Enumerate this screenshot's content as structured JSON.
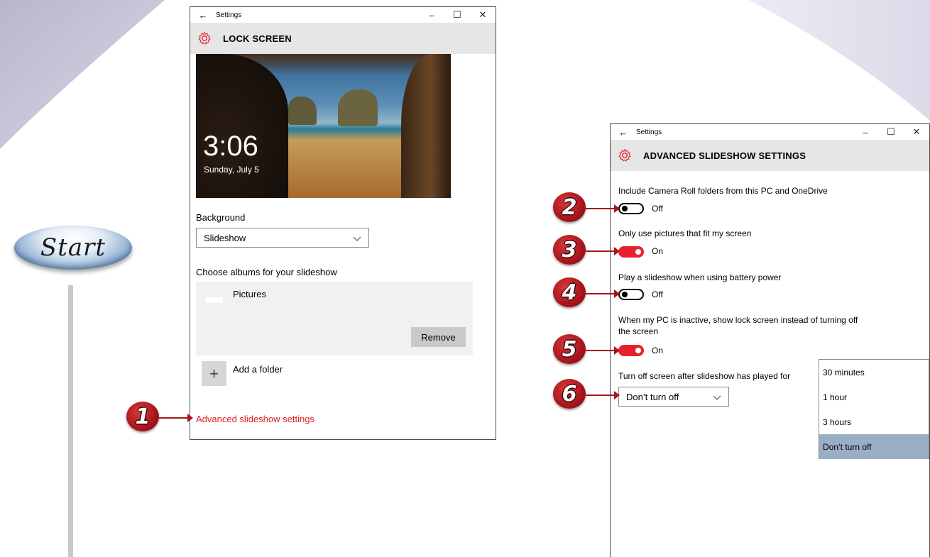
{
  "badge": {
    "label": "Start"
  },
  "window1": {
    "back_glyph": "←",
    "app_title": "Settings",
    "minimize_glyph": "–",
    "maximize_glyph": "☐",
    "close_glyph": "✕",
    "header_title": "LOCK SCREEN",
    "preview_time": "3:06",
    "preview_date": "Sunday, July 5",
    "background_label": "Background",
    "background_value": "Slideshow",
    "albums_label": "Choose albums for your slideshow",
    "album_name": "Pictures",
    "remove_label": "Remove",
    "add_folder_label": "Add a folder",
    "add_glyph": "+",
    "advanced_link": "Advanced slideshow settings"
  },
  "window2": {
    "back_glyph": "←",
    "app_title": "Settings",
    "minimize_glyph": "–",
    "maximize_glyph": "☐",
    "close_glyph": "✕",
    "header_title": "ADVANCED SLIDESHOW SETTINGS",
    "settings": [
      {
        "label": "Include Camera Roll folders from this PC and OneDrive",
        "state": "Off"
      },
      {
        "label": "Only use pictures that fit my screen",
        "state": "On"
      },
      {
        "label": "Play a slideshow when using battery power",
        "state": "Off"
      },
      {
        "label": "When my PC is inactive, show lock screen instead of turning off",
        "label2": "the screen",
        "state": "On"
      }
    ],
    "turnoff_label": "Turn off screen after slideshow has played for",
    "turnoff_value": "Don’t turn off",
    "turnoff_options": [
      "30 minutes",
      "1 hour",
      "3 hours",
      "Don’t turn off"
    ],
    "turnoff_selected": "Don’t turn off"
  },
  "callouts": [
    "1",
    "2",
    "3",
    "4",
    "5",
    "6"
  ],
  "colors": {
    "accent": "#e8202e",
    "callout": "#a8141c",
    "selected_option": "#9aaec4"
  }
}
